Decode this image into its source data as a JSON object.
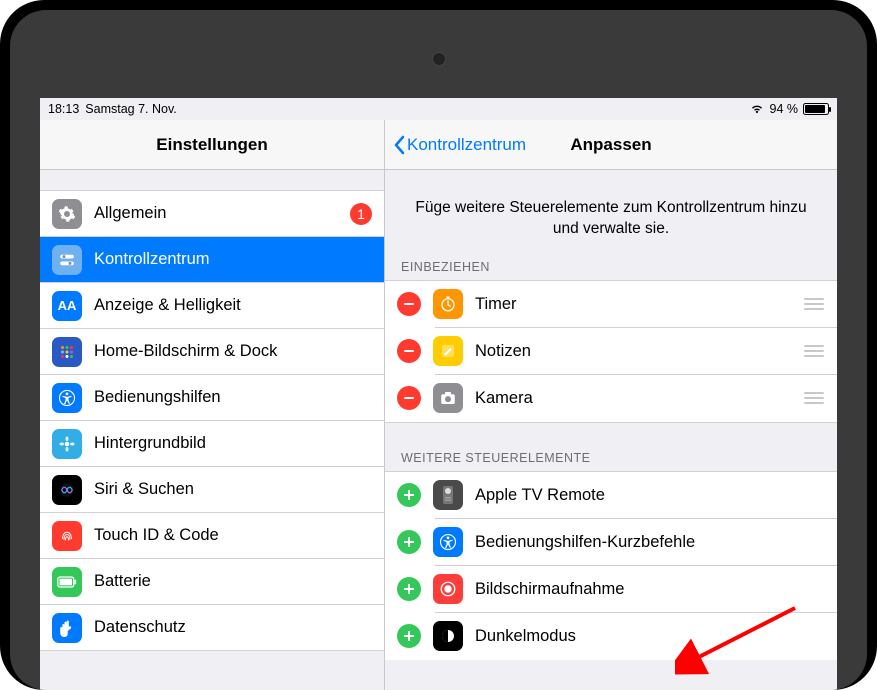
{
  "statusbar": {
    "time": "18:13",
    "date": "Samstag 7. Nov.",
    "battery_pct": "94 %"
  },
  "left": {
    "title": "Einstellungen",
    "items": [
      {
        "label": "Allgemein",
        "badge": "1"
      },
      {
        "label": "Kontrollzentrum"
      },
      {
        "label": "Anzeige & Helligkeit"
      },
      {
        "label": "Home-Bildschirm & Dock"
      },
      {
        "label": "Bedienungshilfen"
      },
      {
        "label": "Hintergrundbild"
      },
      {
        "label": "Siri & Suchen"
      },
      {
        "label": "Touch ID & Code"
      },
      {
        "label": "Batterie"
      },
      {
        "label": "Datenschutz"
      }
    ]
  },
  "right": {
    "back": "Kontrollzentrum",
    "title": "Anpassen",
    "description": "Füge weitere Steuerelemente zum Kontrollzentrum hinzu und verwalte sie.",
    "include_header": "EINBEZIEHEN",
    "include": [
      {
        "label": "Timer"
      },
      {
        "label": "Notizen"
      },
      {
        "label": "Kamera"
      }
    ],
    "more_header": "WEITERE STEUERELEMENTE",
    "more": [
      {
        "label": "Apple TV Remote"
      },
      {
        "label": "Bedienungshilfen-Kurzbefehle"
      },
      {
        "label": "Bildschirmaufnahme"
      },
      {
        "label": "Dunkelmodus"
      }
    ]
  }
}
